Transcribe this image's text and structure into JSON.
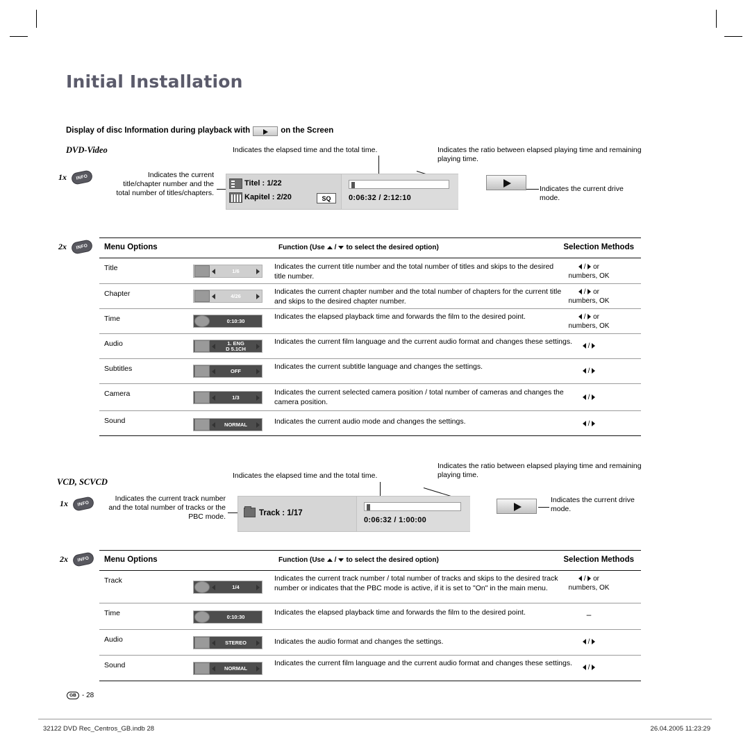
{
  "page": {
    "title": "Initial Installation",
    "subheading_before": "Display of disc Information during playback with",
    "subheading_after": "on the Screen",
    "page_number_badge": "GB",
    "page_number": "- 28",
    "footer_left": "32122 DVD Rec_Centros_GB.indb   28",
    "footer_right": "26.04.2005   11:23:29"
  },
  "dvd": {
    "section_label": "DVD-Video",
    "press_1x": "1x",
    "press_2x": "2x",
    "info_badge": "INFO",
    "note_left": "Indicates the current title/chapter number and the total number of titles/chapters.",
    "note_center": "Indicates the elapsed time and the total time.",
    "note_right": "Indicates the ratio between elapsed playing time and remaining playing time.",
    "note_drive": "Indicates the current drive mode.",
    "osd": {
      "title_row": "Titel : 1/22",
      "chapter_row": "Kapitel : 2/20",
      "badge": "SQ",
      "timecode": "0:06:32  /  2:12:10"
    }
  },
  "vcd": {
    "section_label": "VCD, SCVCD",
    "press_1x": "1x",
    "press_2x": "2x",
    "info_badge": "INFO",
    "note_left": "Indicates the current track number and the total number of tracks or the PBC mode.",
    "note_center": "Indicates the elapsed time and the total time.",
    "note_right": "Indicates the ratio between elapsed playing time and remaining playing time.",
    "note_drive": "Indicates the current drive mode.",
    "osd": {
      "track_row": "Track : 1/17",
      "timecode": "0:06:32  /  1:00:00"
    }
  },
  "table_headers": {
    "col1": "Menu Options",
    "col2_prefix": "Function (Use",
    "col2_suffix": "to select the desired option)",
    "col3": "Selection Methods"
  },
  "dvd_table": [
    {
      "option": "Title",
      "chip_value": "1/6",
      "chip_icon": "disc-icon",
      "description": "Indicates the current title number and the total number of titles and skips to the desired title number.",
      "selection_line1": "or",
      "selection_line2": "numbers, OK"
    },
    {
      "option": "Chapter",
      "chip_value": "4/26",
      "chip_icon": "film-strip-icon",
      "description": "Indicates the current chapter number and the total number of chapters for the current title and skips to the desired chapter number.",
      "selection_line1": "or",
      "selection_line2": "numbers, OK"
    },
    {
      "option": "Time",
      "chip_value": "0:10:30",
      "chip_icon": "clock-icon",
      "description": "Indicates the elapsed playback time and forwards the film to the desired point.",
      "selection_line1": "or",
      "selection_line2": "numbers, OK"
    },
    {
      "option": "Audio",
      "chip_value": "1.  ENG",
      "chip_value2": "D 5.1CH",
      "chip_icon": "speaker-icon",
      "description": "Indicates the current film language and the current audio format and changes these settings.",
      "selection_line1": "",
      "selection_line2": ""
    },
    {
      "option": "Subtitles",
      "chip_value": "OFF",
      "chip_icon": "subtitle-icon",
      "description": "Indicates the current subtitle language and changes the settings.",
      "selection_line1": "",
      "selection_line2": ""
    },
    {
      "option": "Camera",
      "chip_value": "1/3",
      "chip_icon": "camera-icon",
      "description": "Indicates the current selected camera position / total number of cameras and changes the camera position.",
      "selection_line1": "",
      "selection_line2": ""
    },
    {
      "option": "Sound",
      "chip_value": "NORMAL",
      "chip_icon": "sound-icon",
      "description": "Indicates the current audio mode and changes the settings.",
      "selection_line1": "",
      "selection_line2": ""
    }
  ],
  "vcd_table": [
    {
      "option": "Track",
      "chip_value": "1/4",
      "chip_icon": "disc-icon",
      "description": "Indicates the current track number / total number of tracks and skips to the desired track number or indicates that the PBC mode is active, if it is set to \"On\" in the main menu.",
      "selection_line1": "or",
      "selection_line2": "numbers, OK"
    },
    {
      "option": "Time",
      "chip_value": "0:10:30",
      "chip_icon": "clock-icon",
      "description": "Indicates the elapsed playback time and forwards the film to the desired point.",
      "selection_line1": "–",
      "selection_line2": ""
    },
    {
      "option": "Audio",
      "chip_value": "STEREO",
      "chip_icon": "speaker-icon",
      "description": "Indicates the audio format and changes the settings.",
      "selection_line1": "",
      "selection_line2": ""
    },
    {
      "option": "Sound",
      "chip_value": "NORMAL",
      "chip_icon": "sound-icon",
      "description": "Indicates the current film language and the current audio format and changes these settings.",
      "selection_line1": "",
      "selection_line2": ""
    }
  ]
}
